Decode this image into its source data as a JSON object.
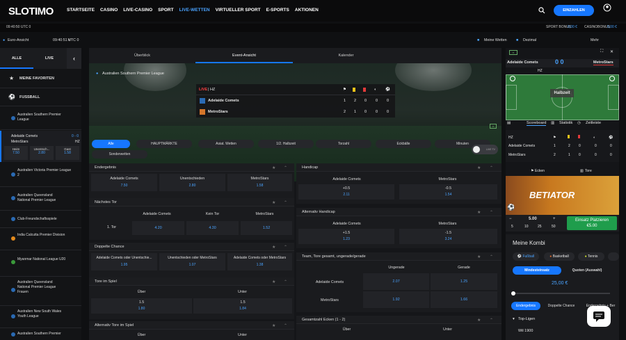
{
  "brand": "SLOTIMO",
  "nav": [
    "STARTSEITE",
    "CASINO",
    "LIVE-CASINO",
    "SPORT",
    "LIVE-WETTEN",
    "VIRTUELLER SPORT",
    "E-SPORTS",
    "AKTIONEN"
  ],
  "nav_active": "LIVE-WETTEN",
  "login": "EINZAHLEN",
  "status": {
    "time": "09:40:50 UTC 0",
    "sport_bonus_label": "SPORT BONUS",
    "sport_bonus": "0,00 €",
    "casino_bonus_label": "CASINOBONUS",
    "casino_bonus": "0,00 €"
  },
  "subbar": {
    "view": "Euro-Ansicht",
    "time": "09:40:51 UTC 0",
    "my_bets": "Meine Wetten",
    "odds_format": "Dezimal",
    "more": "Mehr"
  },
  "left": {
    "tabs": [
      "ALLE",
      "LIVE"
    ],
    "favorites": "MEINE FAVORITEN",
    "football": "FUSSBALL",
    "leagues": [
      "Australien Southern Premier League",
      "Australien Victoria Premier League 2",
      "Australien Queensland National Premier League",
      "Club-Freundschaftsspiele",
      "India Calcutta Premier Division",
      "Myanmar National League U20",
      "Australien Queensland National Premier League Frauen",
      "Australien New South Wales Youth League",
      "Australien Southern Premier"
    ],
    "match": {
      "home": "Adelaide Comets",
      "away": "MetroStars",
      "score": "0 - 0",
      "period": "HZ",
      "odds_labels": [
        "Heim",
        "Unentsch...",
        "Gast"
      ],
      "odds": [
        "7.50",
        "2.80",
        "1.58"
      ]
    }
  },
  "center": {
    "tabs": [
      "Überblick",
      "Event-Ansicht",
      "Kalender"
    ],
    "active_tab": "Event-Ansicht",
    "league": "Australien Southern Premier League",
    "scoreboard": {
      "live": "LIVE",
      "period": "| HZ",
      "teams": [
        {
          "name": "Adelaide Comets",
          "vals": [
            "1",
            "2",
            "0",
            "0",
            "0"
          ]
        },
        {
          "name": "MetroStars",
          "vals": [
            "2",
            "1",
            "0",
            "0",
            "0"
          ]
        }
      ]
    },
    "filters": [
      "Alle",
      "HAUPTMÄRKTE",
      "Asiat. Wetten",
      "1/2. Halbzeit",
      "Torzahl",
      "Eckbälle",
      "Minuten",
      "Sonderwetten"
    ],
    "toggle": "LIVE TV",
    "markets": {
      "endergebnis": {
        "title": "Endergebnis",
        "opts": [
          {
            "l": "Adelaide Comets",
            "v": "7.50"
          },
          {
            "l": "Unentschieden",
            "v": "2.80"
          },
          {
            "l": "MetroStars",
            "v": "1.58"
          }
        ]
      },
      "naechstes_tor": {
        "title": "Nächstes Tor",
        "cols": [
          "Adelaide Comets",
          "Kein Tor",
          "MetroStars"
        ],
        "row": "1. Tor",
        "vals": [
          "4.20",
          "4.30",
          "1.52"
        ]
      },
      "doppelte": {
        "title": "Doppelte Chance",
        "opts": [
          {
            "l": "Adelaide Comets oder Unentschie...",
            "v": "1.95"
          },
          {
            "l": "Unentschieden oder MetroStars",
            "v": "1.07"
          },
          {
            "l": "Adelaide Comets oder MetroStars",
            "v": "1.38"
          }
        ]
      },
      "tore": {
        "title": "Tore im Spiel",
        "cols": [
          "Über",
          "Unter"
        ],
        "opts": [
          {
            "l": "1.5",
            "v": "1.80"
          },
          {
            "l": "1.5",
            "v": "1.84"
          }
        ]
      },
      "alt_tore": {
        "title": "Alternativ Tore im Spiel",
        "cols": [
          "Über",
          "Unter"
        ]
      },
      "handicap": {
        "title": "Handicap",
        "cols": [
          "Adelaide Comets",
          "MetroStars"
        ],
        "opts": [
          {
            "l": "+0.5",
            "v": "2.11"
          },
          {
            "l": "-0.5",
            "v": "1.54"
          }
        ]
      },
      "alt_handicap": {
        "title": "Alternativ Handicap",
        "cols": [
          "Adelaide Comets",
          "MetroStars"
        ],
        "opts": [
          {
            "l": "+1.5",
            "v": "1.23"
          },
          {
            "l": "-1.5",
            "v": "3.24"
          }
        ]
      },
      "ungerade": {
        "title": "Team, Tore gesamt, ungerade/gerade",
        "cols": [
          "Ungerade",
          "Gerade"
        ],
        "rows": [
          {
            "t": "Adelaide Comets",
            "v": [
              "2.07",
              "1.25"
            ]
          },
          {
            "t": "MetroStars",
            "v": [
              "1.92",
              "1.66"
            ]
          }
        ]
      },
      "ecken": {
        "title": "Gesamtzahl Ecken  (1 - 2)",
        "cols": [
          "Über",
          "Unter"
        ]
      }
    }
  },
  "right": {
    "home": "Adelaide Comets",
    "away": "MetroStars",
    "score": "0 0",
    "period": "HZ",
    "halftime": "Halbzeit",
    "tabs": [
      "Scoreboard",
      "Statistik",
      "Zeitleiste"
    ],
    "sb": [
      {
        "t": "Adelaide Comets",
        "v": [
          "1",
          "2",
          "0",
          "0",
          "0"
        ]
      },
      {
        "t": "MetroStars",
        "v": [
          "2",
          "1",
          "0",
          "0",
          "0"
        ]
      }
    ],
    "sb_hz": "HZ",
    "corners": "Ecken",
    "goals": "Tore",
    "ad": {
      "brand": "BETIATOR",
      "odds": [
        "5.00",
        "0.00"
      ],
      "stakes": [
        "5",
        "10",
        "25",
        "50"
      ],
      "cta": "Einsatz Platzieren",
      "cta_amount": "€5.00"
    },
    "kombi": {
      "title": "Meine Kombi",
      "sports": [
        "Fußball",
        "Basketball",
        "Tennis"
      ],
      "tabs": [
        "Mindesteinsatz",
        "Quoten (Auswahl)"
      ],
      "amount": "25,00 €",
      "cats": [
        "Endergebnis",
        "Doppelte Chance",
        "Endergebnis + Ber"
      ],
      "top": "Top-Ligen",
      "wil": "Wil 1900"
    }
  }
}
